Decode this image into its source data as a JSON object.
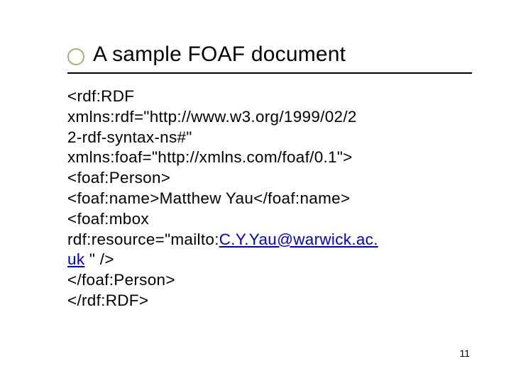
{
  "title": "A sample FOAF document",
  "code": {
    "l1": "<rdf:RDF",
    "l2": "xmlns:rdf=\"http://www.w3.org/1999/02/2",
    "l3": "2-rdf-syntax-ns#\"",
    "l4": "xmlns:foaf=\"http://xmlns.com/foaf/0.1\">",
    "l5": "<foaf:Person>",
    "l6": "<foaf:name>Matthew Yau</foaf:name>",
    "l7": "<foaf:mbox",
    "l8a": "rdf:resource=\"mailto:",
    "l8link": "C.Y.Yau@warwick.ac.",
    "l9link": "uk",
    "l9b": " \" />",
    "l10": "</foaf:Person>",
    "l11": "</rdf:RDF>"
  },
  "page_number": "11"
}
